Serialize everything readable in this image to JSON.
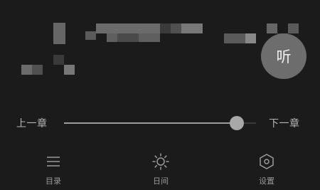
{
  "listen": {
    "label": "听"
  },
  "chapter_nav": {
    "prev_label": "上一章",
    "next_label": "下一章",
    "progress": 0.9
  },
  "bottom_nav": [
    {
      "label": "目录",
      "icon": "menu-list-icon"
    },
    {
      "label": "日间",
      "icon": "sun-icon"
    },
    {
      "label": "设置",
      "icon": "hexagon-settings-icon"
    }
  ],
  "colors": {
    "background": "#1b1b1b",
    "text": "#b4b4b4",
    "button": "#6d6d6d",
    "slider": "#a8a8a8"
  }
}
